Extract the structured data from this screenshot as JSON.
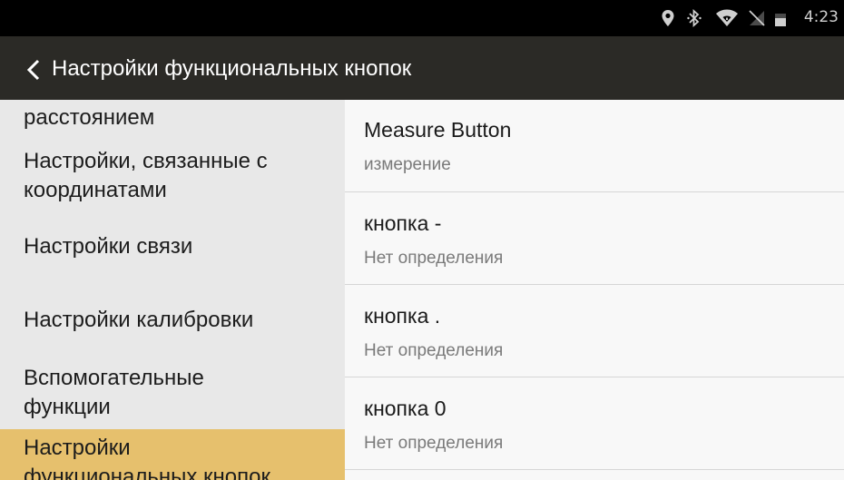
{
  "status_bar": {
    "time": "4:23",
    "icons": [
      "location-icon",
      "bluetooth-icon",
      "wifi-icon",
      "no-sim-icon",
      "battery-icon"
    ]
  },
  "toolbar": {
    "back_icon": "chevron-left-icon",
    "title": "Настройки функциональных кнопок"
  },
  "categories": [
    {
      "label": "расстоянием",
      "active": false
    },
    {
      "label_line1": "Настройки, связанные с",
      "label_line2": "координатами",
      "active": false
    },
    {
      "label": "Настройки связи",
      "active": false
    },
    {
      "label": "Настройки калибровки",
      "active": false
    },
    {
      "label_line1": "Вспомогательные",
      "label_line2": "функции",
      "active": false
    },
    {
      "label_line1": "Настройки",
      "label_line2": "функциональных кнопок",
      "active": true
    }
  ],
  "buttons": [
    {
      "title": "Measure Button",
      "subtitle": "измерение"
    },
    {
      "title": "кнопка -",
      "subtitle": "Нет определения"
    },
    {
      "title": "кнопка .",
      "subtitle": "Нет определения"
    },
    {
      "title": "кнопка 0",
      "subtitle": "Нет определения"
    }
  ],
  "colors": {
    "status_bar_bg": "#000000",
    "toolbar_bg": "#2b2a26",
    "left_panel_bg": "#e8e8e8",
    "active_category_bg": "#e6c06d",
    "right_panel_bg": "#f8f8f8"
  }
}
